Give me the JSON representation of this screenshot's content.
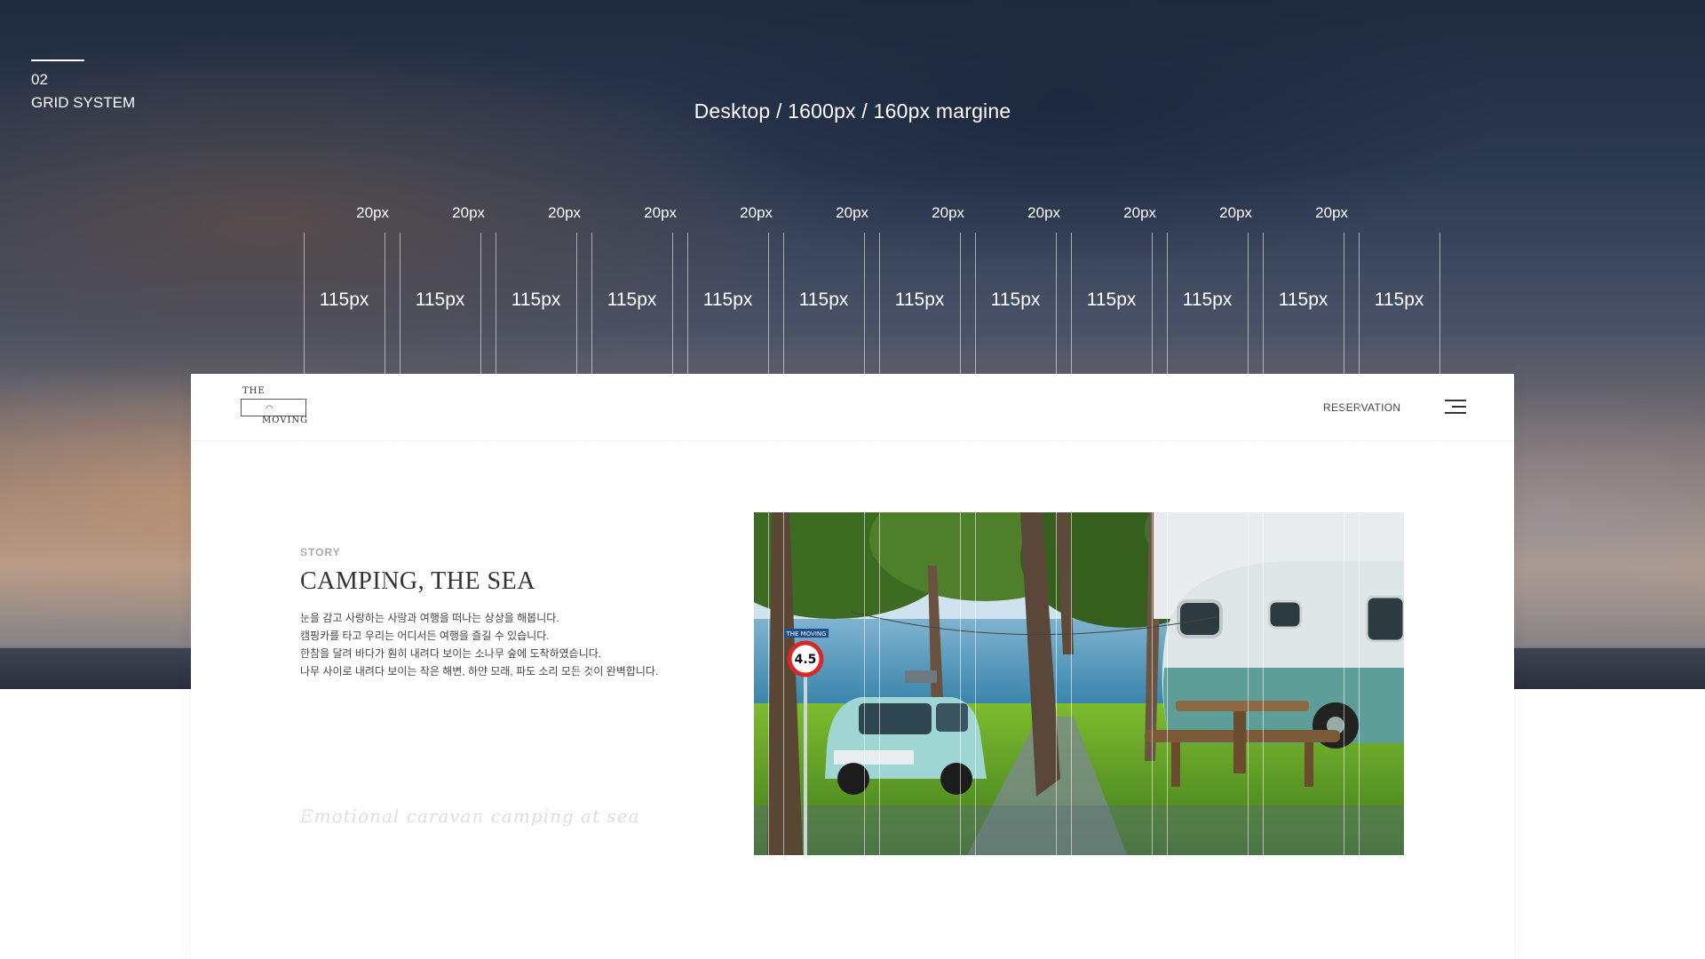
{
  "section": {
    "number": "02",
    "title": "GRID SYSTEM"
  },
  "grid": {
    "heading": "Desktop / 1600px / 160px margine",
    "gutter_label": "20px",
    "column_label": "115px",
    "gutter_count": 11,
    "column_count": 12
  },
  "site": {
    "logo_top": "THE",
    "logo_bottom": "MOVING",
    "reservation": "RESERVATION",
    "menu_icon": "hamburger-menu-icon"
  },
  "story": {
    "kicker": "STORY",
    "title": "CAMPING, THE SEA",
    "lines": [
      "눈을 감고 사랑하는 사람과 여행을 떠나는 상상을 해봅니다.",
      "캠핑카를 타고 우리는 어디서든 여행을 즐길 수 있습니다.",
      "한참을 달려 바다가 훤히 내려다 보이는 소나무 숲에 도착하였습니다.",
      "나무 사이로 내려다 보이는 작은 해변, 하얀 모래, 파도 소리 모든 것이 완벽합니다."
    ],
    "script": "Emotional caravan camping at sea"
  },
  "photo": {
    "sign_label": "THE MOVING",
    "speed_limit": "4.5"
  }
}
